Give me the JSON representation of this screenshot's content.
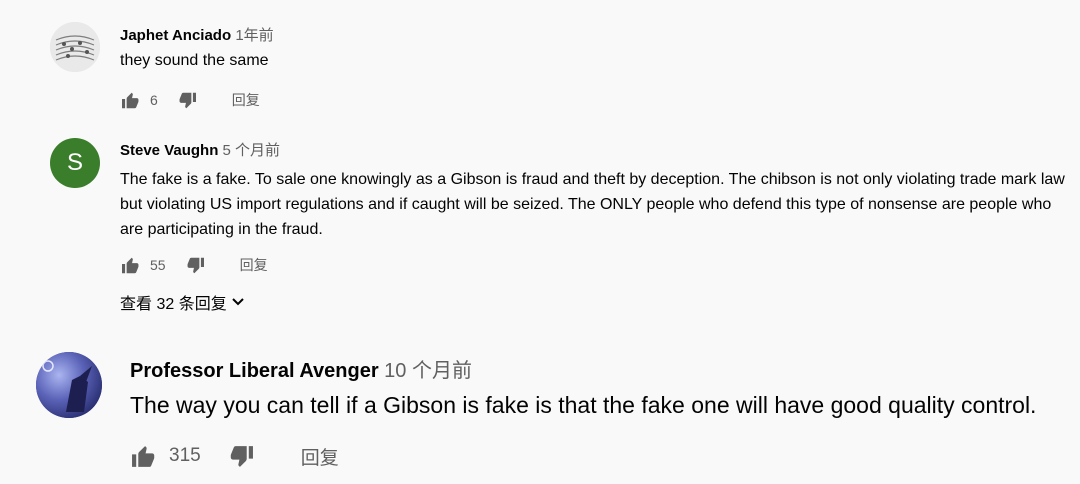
{
  "comments": [
    {
      "author": "Japhet Anciado",
      "time": "1年前",
      "text": "they sound the same",
      "likes": "6",
      "reply_label": "回复",
      "avatar": {
        "type": "image",
        "colors": [
          "#d8d8d8",
          "#8a8a8a"
        ]
      }
    },
    {
      "author": "Steve Vaughn",
      "time": "5 个月前",
      "text": "The fake is a fake. To sale one knowingly as a Gibson is fraud and theft by deception. The chibson is not only violating trade mark law but violating US import regulations and if caught will be seized. The ONLY people who defend this type of nonsense are people who are participating in the fraud.",
      "likes": "55",
      "reply_label": "回复",
      "view_replies_label": "查看 32 条回复",
      "avatar": {
        "type": "letter",
        "letter": "S",
        "color": "#3a7d2a"
      }
    },
    {
      "author": "Professor Liberal Avenger",
      "time": "10 个月前",
      "text": "The way you can tell if a Gibson is fake is that the fake one will have good quality control.",
      "likes": "315",
      "reply_label": "回复",
      "avatar": {
        "type": "image",
        "colors": [
          "#3b3f8f",
          "#9aa6e0"
        ]
      }
    }
  ]
}
